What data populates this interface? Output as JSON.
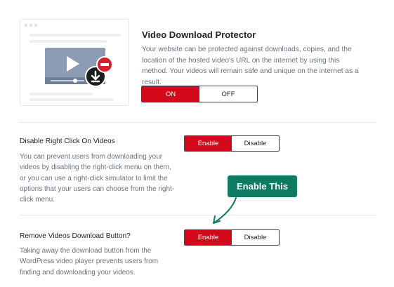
{
  "protector": {
    "title": "Video Download Protector",
    "description": "Your website can be protected against downloads, copies, and the location of the hosted video's URL on the internet by using this method. Your videos will remain safe and unique on the internet as a result.",
    "on_label": "ON",
    "off_label": "OFF",
    "selected": "ON"
  },
  "right_click": {
    "title": "Disable Right Click On Videos",
    "description": "You can prevent users from downloading your videos by disabling the right-click menu on them, or you can use a right-click simulator to limit the options that your users can choose from the right-click menu.",
    "enable_label": "Enable",
    "disable_label": "Disable",
    "selected": "Enable"
  },
  "download_button": {
    "title": "Remove Videos Download Button?",
    "description": "Taking away the download button from the WordPress video player prevents users from finding and downloading your videos.",
    "enable_label": "Enable",
    "disable_label": "Disable",
    "selected": "Enable"
  },
  "callout": {
    "label": "Enable This"
  },
  "colors": {
    "accent": "#d3081b",
    "callout": "#0f7a62"
  }
}
